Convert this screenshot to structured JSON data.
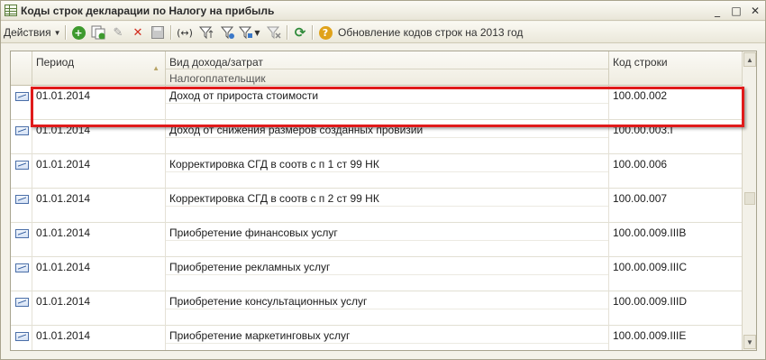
{
  "window": {
    "title": "Коды строк декларации по Налогу на прибыль",
    "minimize_glyph": "_",
    "maximize_glyph": "□",
    "close_glyph": "✕"
  },
  "toolbar": {
    "actions_label": "Действия",
    "help_glyph": "?",
    "update_label": "Обновление кодов строк на 2013 год",
    "icons": [
      "add-icon",
      "copy-icon",
      "edit-icon",
      "delete-icon",
      "save-icon",
      "period-icon",
      "filter-icon",
      "filter-list-icon",
      "clear-filter-icon",
      "help-icon",
      "refresh-icon"
    ]
  },
  "table": {
    "columns": {
      "period": "Период",
      "income_type": "Вид дохода/затрат",
      "taxpayer": "Налогоплательщик",
      "line_code": "Код строки"
    },
    "rows": [
      {
        "period": "01.01.2014",
        "income_type": "Доход от прироста стоимости",
        "line_code": "100.00.002"
      },
      {
        "period": "01.01.2014",
        "income_type": "Доход от снижения размеров созданных провизий",
        "line_code": "100.00.003.I"
      },
      {
        "period": "01.01.2014",
        "income_type": "Корректировка СГД в соотв с п 1 ст 99 НК",
        "line_code": "100.00.006"
      },
      {
        "period": "01.01.2014",
        "income_type": "Корректировка СГД в соотв с п 2 ст 99 НК",
        "line_code": "100.00.007"
      },
      {
        "period": "01.01.2014",
        "income_type": "Приобретение финансовых услуг",
        "line_code": "100.00.009.IIIB"
      },
      {
        "period": "01.01.2014",
        "income_type": "Приобретение рекламных услуг",
        "line_code": "100.00.009.IIIC"
      },
      {
        "period": "01.01.2014",
        "income_type": "Приобретение консультационных услуг",
        "line_code": "100.00.009.IIID"
      },
      {
        "period": "01.01.2014",
        "income_type": "Приобретение маркетинговых услуг",
        "line_code": "100.00.009.IIIE"
      }
    ]
  },
  "colors": {
    "highlight": "#e01b1b",
    "add": "#3e9a2e",
    "delete": "#d12a1c",
    "refresh": "#2f8a3a",
    "help": "#e0a21a"
  }
}
